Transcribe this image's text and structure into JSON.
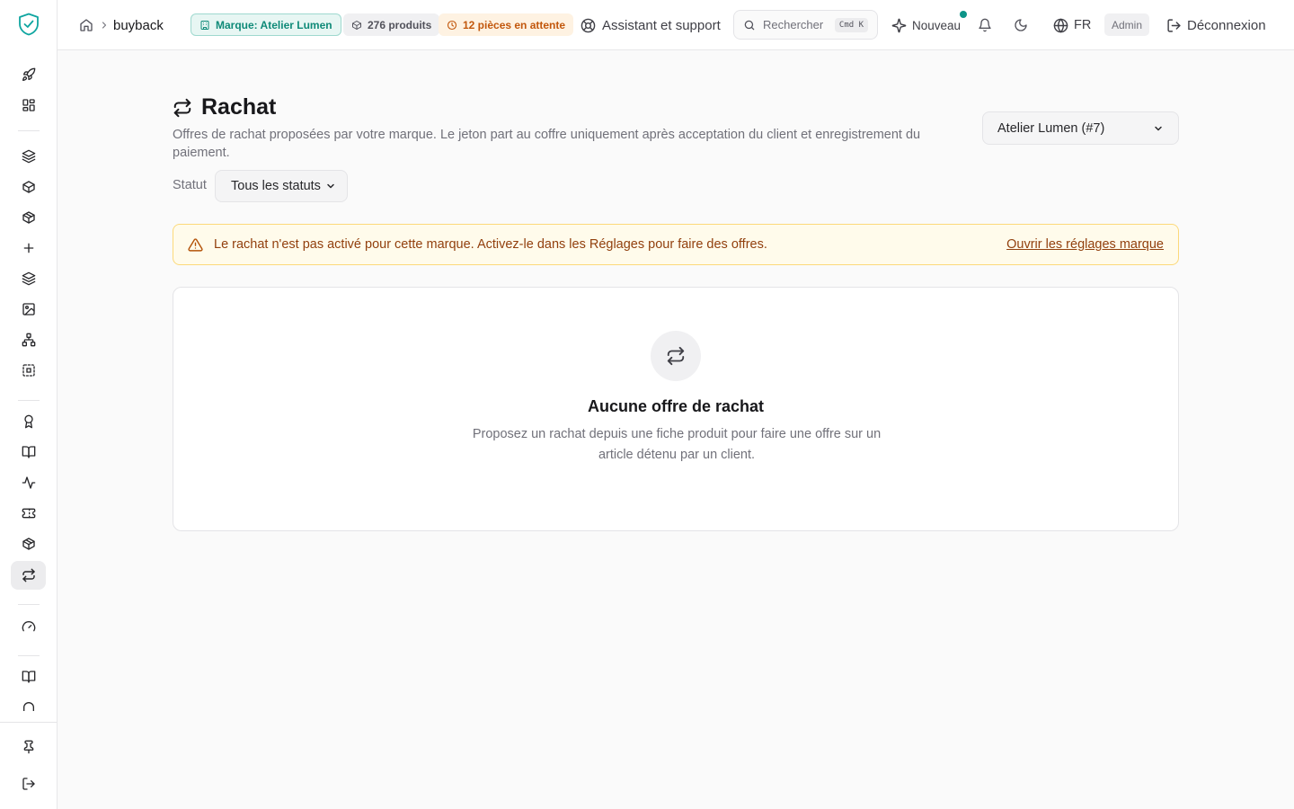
{
  "sidebar": {
    "items": [
      {
        "icon": "rocket-icon"
      },
      {
        "icon": "dashboard-grid-icon"
      },
      {
        "icon": "layers-icon"
      },
      {
        "icon": "box-icon"
      },
      {
        "icon": "package-icon"
      },
      {
        "icon": "plus-icon"
      },
      {
        "icon": "stack-icon"
      },
      {
        "icon": "image-icon"
      },
      {
        "icon": "network-icon"
      },
      {
        "icon": "dashed-frame-icon"
      },
      {
        "icon": "award-icon"
      },
      {
        "icon": "book-open-icon"
      },
      {
        "icon": "activity-icon"
      },
      {
        "icon": "ticket-icon"
      },
      {
        "icon": "package-check-icon"
      },
      {
        "icon": "repeat-icon",
        "active": true
      },
      {
        "icon": "gauge-icon"
      },
      {
        "icon": "book-icon"
      },
      {
        "icon": "arch-icon"
      },
      {
        "icon": "pin-icon"
      },
      {
        "icon": "logout-icon"
      }
    ]
  },
  "header": {
    "breadcrumb": "buyback",
    "brand_pill": "Marque: Atelier Lumen",
    "products_pill": "276 produits",
    "pending_pill": "12 pièces en attente",
    "support_label": "Assistant et support",
    "search_placeholder": "Rechercher",
    "search_shortcut": "Cmd K",
    "new_label": "Nouveau",
    "language": "FR",
    "role": "Admin",
    "logout_label": "Déconnexion"
  },
  "main": {
    "title": "Rachat",
    "description": "Offres de rachat proposées par votre marque. Le jeton part au coffre uniquement après acceptation du client et enregistrement du paiement.",
    "brand_select": "Atelier Lumen (#7)",
    "filter_label": "Statut",
    "status_select": "Tous les statuts",
    "alert": {
      "text": "Le rachat n'est pas activé pour cette marque. Activez-le dans les Réglages pour faire des offres.",
      "link": "Ouvrir les réglages marque"
    },
    "empty": {
      "title": "Aucune offre de rachat",
      "description": "Proposez un rachat depuis une fiche produit pour faire une offre sur un article détenu par un client."
    }
  },
  "colors": {
    "accent": "#0d9488",
    "warning_bg": "#fffbeb",
    "warning_text": "#92400e",
    "pending": "#c2570c"
  }
}
